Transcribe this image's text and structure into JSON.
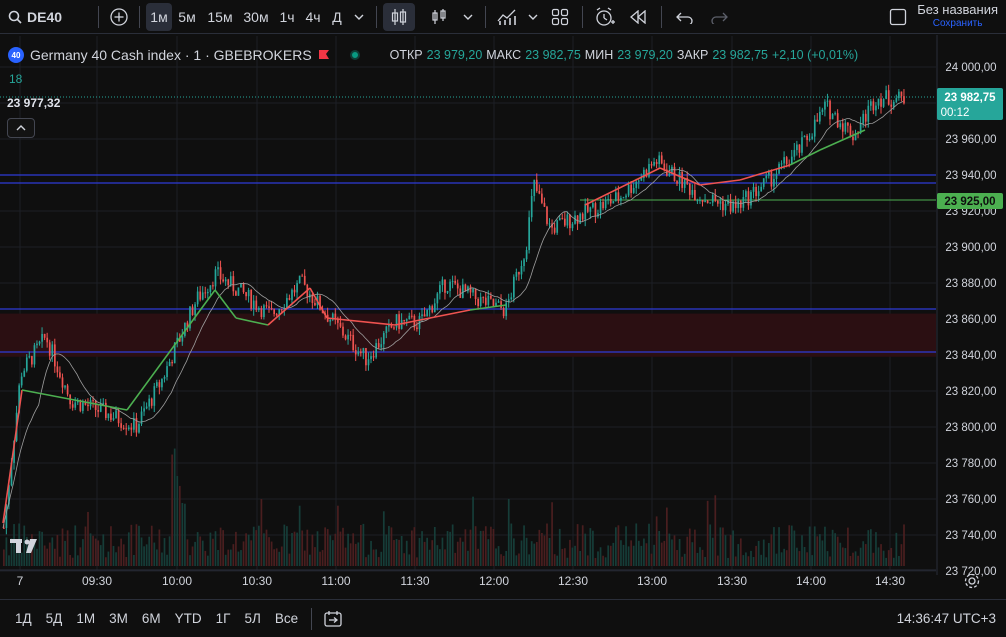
{
  "symbol": "DE40",
  "toolbar": {
    "intervals": [
      "1м",
      "5м",
      "15м",
      "30м",
      "1ч",
      "4ч",
      "Д"
    ],
    "active_interval": "1м",
    "layout_name": "Без названия",
    "save_label": "Сохранить"
  },
  "legend": {
    "badge": "40",
    "title": "Germany 40 Cash index · 1 · GBEBROKERS",
    "open_label": "ОТКР",
    "open": "23 979,20",
    "high_label": "МАКС",
    "high": "23 982,75",
    "low_label": "МИН",
    "low": "23 979,20",
    "close_label": "ЗАКР",
    "close": "23 982,75",
    "change": "+2,10 (+0,01%)",
    "indicator_value": "18",
    "crosshair_value": "23 977,32"
  },
  "price_axis": {
    "ticks": [
      "24 000,00",
      "23 980,00",
      "23 960,00",
      "23 940,00",
      "23 920,00",
      "23 900,00",
      "23 880,00",
      "23 860,00",
      "23 840,00",
      "23 820,00",
      "23 800,00",
      "23 780,00",
      "23 760,00",
      "23 740,00",
      "23 720,00"
    ],
    "last_price": "23 982,75",
    "countdown": "00:12",
    "level_label": "23 925,00"
  },
  "time_axis": {
    "ticks": [
      "7",
      "09:30",
      "10:00",
      "10:30",
      "11:00",
      "11:30",
      "12:00",
      "12:30",
      "13:00",
      "13:30",
      "14:00",
      "14:30"
    ]
  },
  "bottom": {
    "ranges": [
      "1Д",
      "5Д",
      "1М",
      "3М",
      "6М",
      "YTD",
      "1Г",
      "5Л",
      "Все"
    ],
    "clock": "14:36:47 UTC+3"
  },
  "colors": {
    "up": "#26a69a",
    "down": "#ef5350",
    "bg": "#0f0f0f",
    "level_blue": "#2e3bd6",
    "level_green": "#4caf50"
  },
  "chart_data": {
    "type": "candlestick",
    "ylim": [
      23715,
      24010
    ],
    "x": [
      "09:15",
      "09:30",
      "09:45",
      "10:00",
      "10:15",
      "10:30",
      "10:45",
      "11:00",
      "11:15",
      "11:30",
      "11:45",
      "12:00",
      "12:15",
      "12:30",
      "12:45",
      "13:00",
      "13:15",
      "13:30",
      "13:45",
      "14:00",
      "14:15",
      "14:30",
      "14:36"
    ],
    "close": [
      23744,
      23820,
      23800,
      23840,
      23885,
      23868,
      23875,
      23862,
      23850,
      23855,
      23885,
      23878,
      23935,
      23915,
      23932,
      23950,
      23935,
      23928,
      23945,
      23975,
      23962,
      23972,
      23982.75
    ],
    "horizontal_levels": [
      23938,
      23934,
      23925,
      23863,
      23839
    ],
    "zone": [
      23839,
      23863
    ]
  }
}
